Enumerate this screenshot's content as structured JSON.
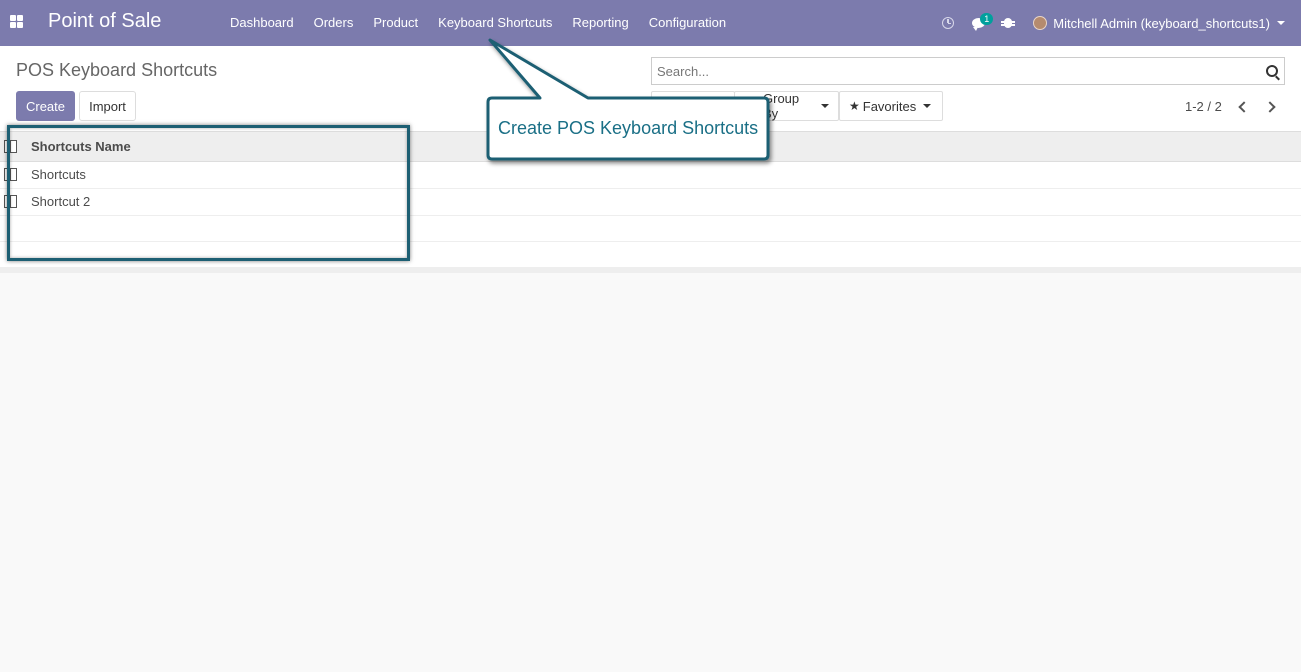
{
  "navbar": {
    "brand": "Point of Sale",
    "menu": [
      "Dashboard",
      "Orders",
      "Product",
      "Keyboard Shortcuts",
      "Reporting",
      "Configuration"
    ],
    "message_count": "1",
    "user_name": "Mitchell Admin (keyboard_shortcuts1)",
    "color": "#7c7bad"
  },
  "control_panel": {
    "title": "POS Keyboard Shortcuts",
    "create_label": "Create",
    "import_label": "Import",
    "search_placeholder": "Search...",
    "group_by_label": "Group By",
    "favorites_label": "Favorites",
    "pager": "1-2 / 2"
  },
  "table": {
    "column_header": "Shortcuts Name",
    "rows": [
      "Shortcuts",
      "Shortcut 2"
    ]
  },
  "annotation": {
    "callout_text": "Create POS Keyboard Shortcuts",
    "color": "#1d5f73"
  }
}
